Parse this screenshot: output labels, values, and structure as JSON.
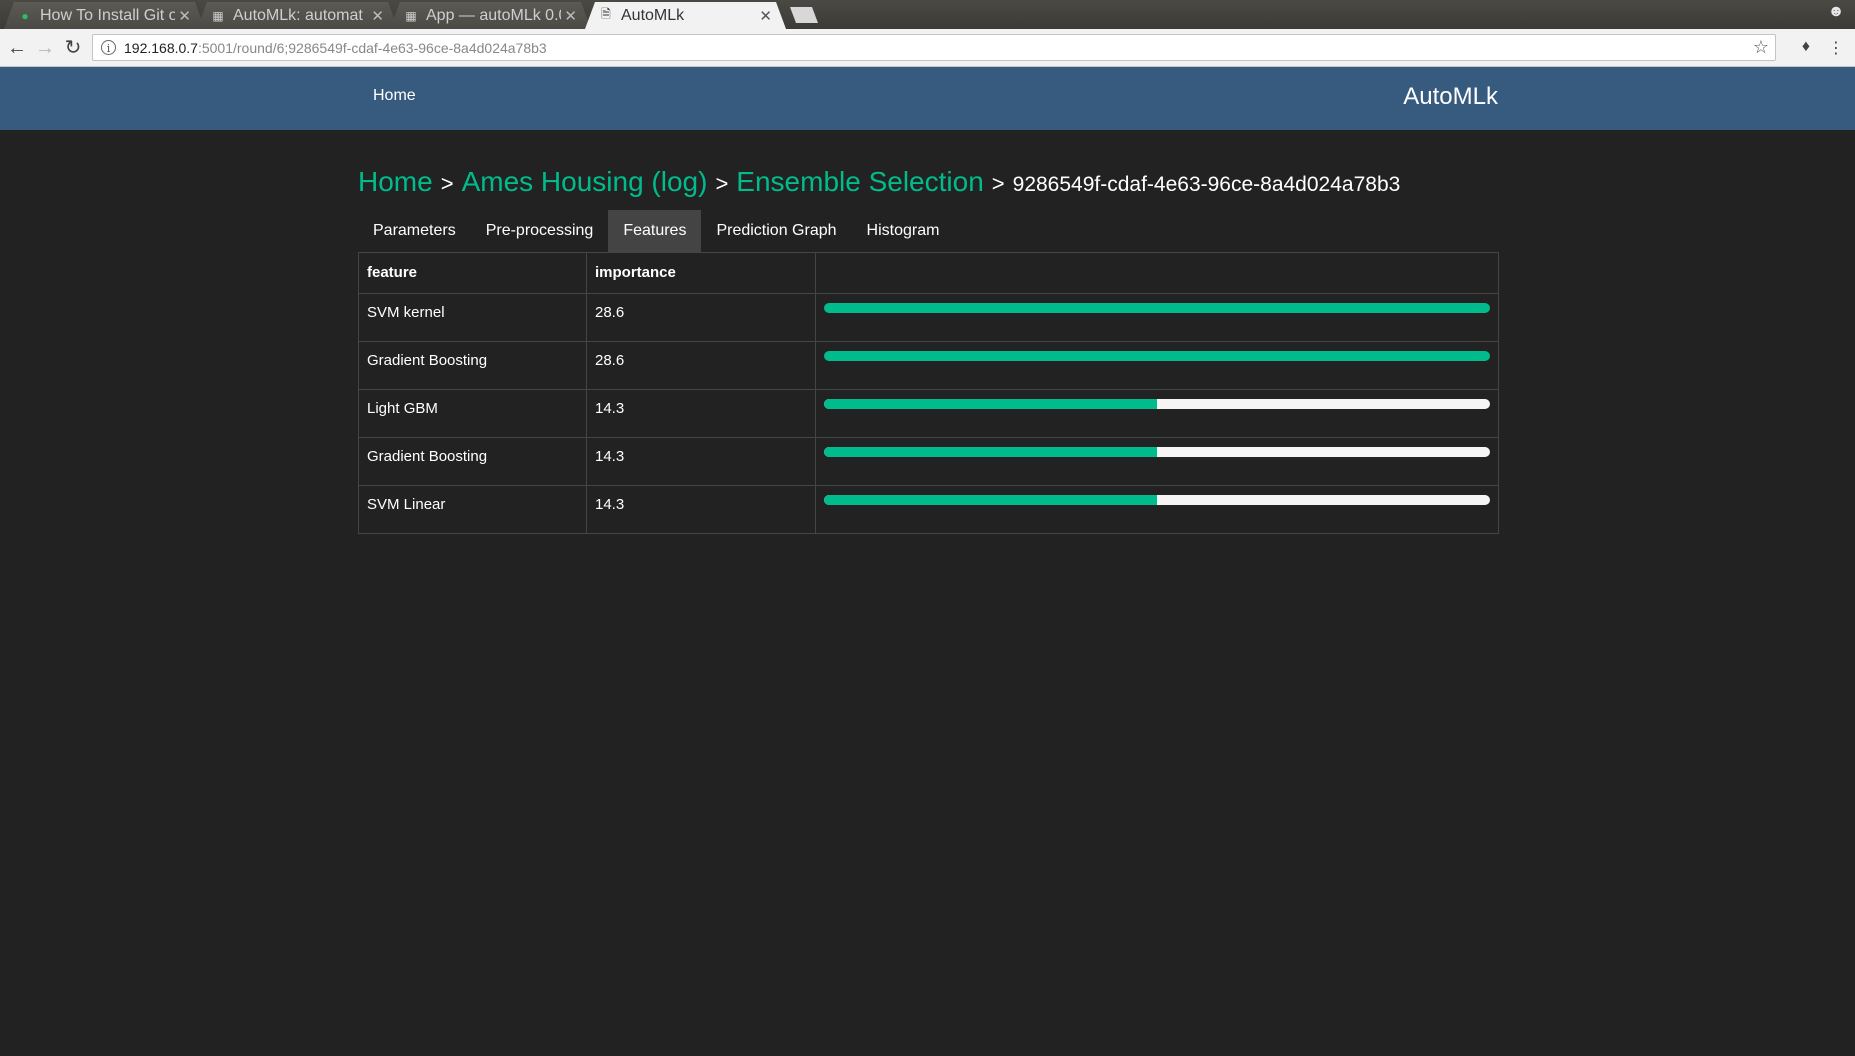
{
  "browser": {
    "tabs": [
      {
        "title": "How To Install Git o",
        "icon": "evernote-icon",
        "active": false
      },
      {
        "title": "AutoMLk: automat",
        "icon": "doc-icon",
        "active": false
      },
      {
        "title": "App — autoMLk 0.0",
        "icon": "doc-icon",
        "active": false
      },
      {
        "title": "AutoMLk",
        "icon": "page-icon",
        "active": true
      }
    ],
    "url_host": "192.168.0.7",
    "url_rest": ":5001/round/6;9286549f-cdaf-4e63-96ce-8a4d024a78b3"
  },
  "navbar": {
    "home_label": "Home",
    "brand": "AutoMLk"
  },
  "breadcrumb": {
    "home": "Home",
    "dataset": "Ames Housing (log)",
    "model": "Ensemble Selection",
    "round_id": "9286549f-cdaf-4e63-96ce-8a4d024a78b3",
    "separator": ">"
  },
  "tabs": [
    "Parameters",
    "Pre-processing",
    "Features",
    "Prediction Graph",
    "Histogram"
  ],
  "active_tab": "Features",
  "table": {
    "headers": [
      "feature",
      "importance",
      ""
    ],
    "rows": [
      {
        "feature": "SVM kernel",
        "importance": "28.6",
        "bar_fraction": 1.0
      },
      {
        "feature": "Gradient Boosting",
        "importance": "28.6",
        "bar_fraction": 1.0
      },
      {
        "feature": "Light GBM",
        "importance": "14.3",
        "bar_fraction": 0.5
      },
      {
        "feature": "Gradient Boosting",
        "importance": "14.3",
        "bar_fraction": 0.5
      },
      {
        "feature": "SVM Linear",
        "importance": "14.3",
        "bar_fraction": 0.5
      }
    ]
  },
  "colors": {
    "accent": "#00bc8c",
    "navbar": "#375a7f",
    "background": "#222222"
  }
}
